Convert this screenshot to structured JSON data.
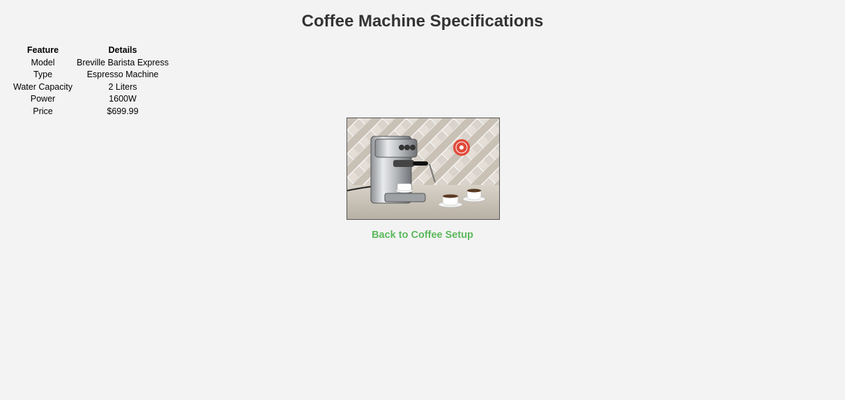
{
  "page": {
    "title": "Coffee Machine Specifications"
  },
  "specs": {
    "headers": [
      "Feature",
      "Details"
    ],
    "rows": [
      {
        "feature": "Model",
        "details": "Breville Barista Express"
      },
      {
        "feature": "Type",
        "details": "Espresso Machine"
      },
      {
        "feature": "Water Capacity",
        "details": "2 Liters"
      },
      {
        "feature": "Power",
        "details": "1600W"
      },
      {
        "feature": "Price",
        "details": "$699.99"
      }
    ]
  },
  "image": {
    "subject": "espresso-machine-photo"
  },
  "nav": {
    "back_label": "Back to Coffee Setup"
  },
  "colors": {
    "background": "#f3f3f3",
    "title": "#333333",
    "link": "#5cb85c"
  }
}
